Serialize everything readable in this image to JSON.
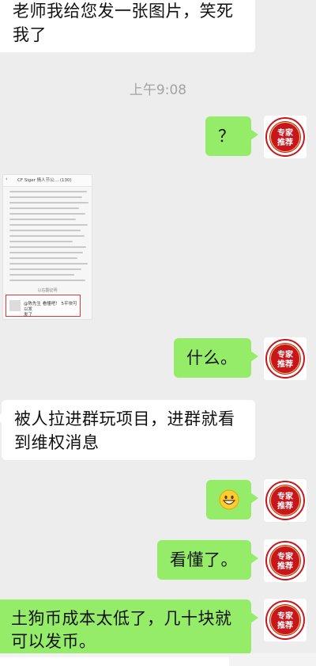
{
  "chat": {
    "msg1": {
      "line1": "老师我给您发一张图片，笑死",
      "line2": "我了"
    },
    "time": "上午9:08",
    "msg2": "？",
    "shot": {
      "title": "CF Siger 情人节公… (130)",
      "back": "‹",
      "box_text_1": "@陈先生 看懂吧！ 5平块可以发",
      "box_text_2": "发了",
      "foot": "以右翻证明"
    },
    "msg3": "什么。",
    "msg4": {
      "line1": "被人拉进群玩项目，进群就看",
      "line2": "到维权消息"
    },
    "msg5_emoji": "grinning-face-emoji",
    "msg6": "看懂了。",
    "msg7": {
      "line1": "土狗币成本太低了，几十块就",
      "line2": "可以发币。"
    },
    "avatar": {
      "line1": "专家",
      "line2": "推荐"
    }
  },
  "colors": {
    "bg": "#ededed",
    "sent": "#95ec69",
    "received": "#ffffff",
    "stamp": "#c8161d"
  }
}
